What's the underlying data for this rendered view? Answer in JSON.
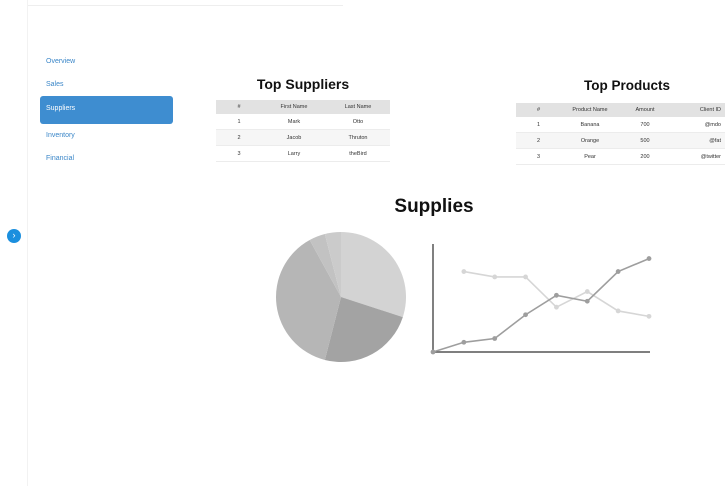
{
  "sidebar": {
    "items": [
      {
        "label": "Overview"
      },
      {
        "label": "Sales"
      },
      {
        "label": "Suppliers"
      },
      {
        "label": "Inventory"
      },
      {
        "label": "Financial"
      }
    ],
    "active": "Suppliers",
    "toggle_icon": "chevron-right-icon"
  },
  "suppliers": {
    "title": "Top Suppliers",
    "columns": [
      "#",
      "First Name",
      "Last Name"
    ],
    "rows": [
      [
        "1",
        "Mark",
        "Otto"
      ],
      [
        "2",
        "Jacob",
        "Thruton"
      ],
      [
        "3",
        "Larry",
        "theBird"
      ]
    ]
  },
  "products": {
    "title": "Top Products",
    "columns": [
      "#",
      "Product Name",
      "Amount",
      "Client ID"
    ],
    "rows": [
      [
        "1",
        "Banana",
        "700",
        "@mdo"
      ],
      [
        "2",
        "Orange",
        "500",
        "@fat"
      ],
      [
        "3",
        "Pear",
        "200",
        "@twitter"
      ]
    ]
  },
  "supplies": {
    "title": "Supplies"
  },
  "colors": {
    "accent": "#3e8dd0",
    "toggle": "#1b8fde"
  },
  "chart_data": [
    {
      "type": "pie",
      "values": [
        30,
        24,
        38,
        4,
        4
      ],
      "colors": [
        "#d3d3d3",
        "#a3a3a3",
        "#b6b6b6",
        "#c2c2c2",
        "#cbcbcb"
      ]
    },
    {
      "type": "line",
      "x": [
        0,
        1,
        2,
        3,
        4,
        5,
        6,
        7
      ],
      "series": [
        {
          "values": [
            0,
            1.8,
            2.5,
            6.9,
            10.5,
            9.4,
            14.9,
            17.3
          ],
          "color": "#9e9e9e"
        },
        {
          "x": [
            1,
            2,
            3,
            4,
            5,
            6,
            7
          ],
          "values": [
            14.9,
            13.9,
            13.9,
            8.3,
            11.2,
            7.6,
            6.6
          ],
          "color": "#d6d6d6"
        }
      ],
      "ylim": [
        0,
        20
      ]
    }
  ]
}
